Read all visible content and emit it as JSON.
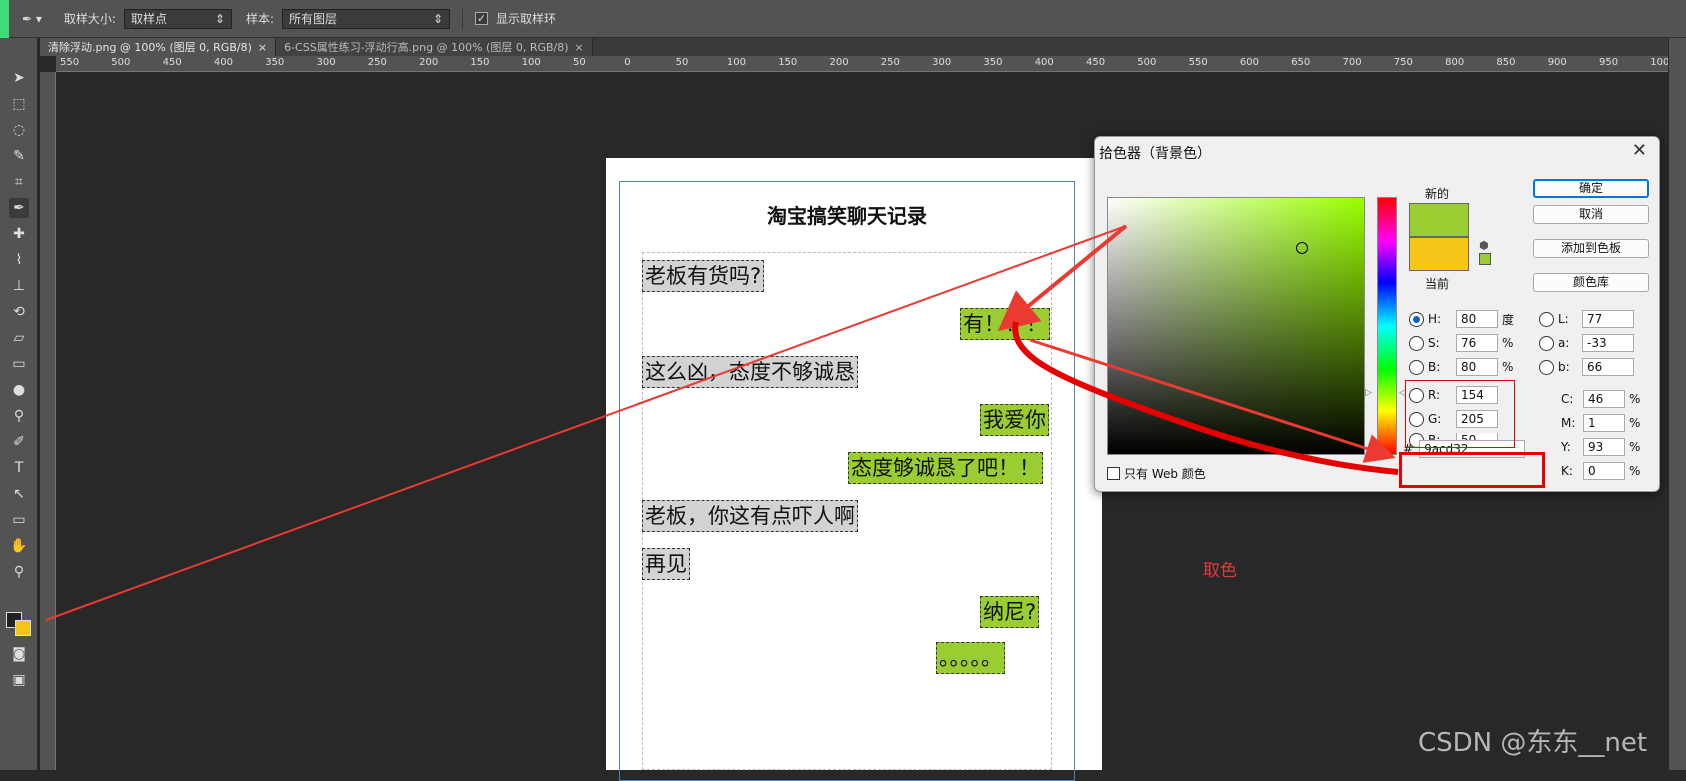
{
  "options": {
    "sample_size_label": "取样大小:",
    "sample_size_value": "取样点",
    "sample_label": "样本:",
    "sample_value": "所有图层",
    "show_ring_label": "显示取样环"
  },
  "tabs": [
    {
      "label": "清除浮动.png @ 100% (图层 0, RGB/8)",
      "close": "×"
    },
    {
      "label": "6-CSS属性练习-浮动行高.png @ 100% (图层 0, RGB/8)",
      "close": "×"
    }
  ],
  "ruler_ticks": [
    "550",
    "500",
    "450",
    "400",
    "350",
    "300",
    "250",
    "200",
    "150",
    "100",
    "50",
    "0",
    "50",
    "100",
    "150",
    "200",
    "250",
    "300",
    "350",
    "400",
    "450",
    "500",
    "550",
    "600",
    "650",
    "700",
    "750",
    "800",
    "850",
    "900",
    "950",
    "1000"
  ],
  "document": {
    "title": "淘宝搞笑聊天记录",
    "messages": [
      {
        "text": "老板有货吗?",
        "side": "left"
      },
      {
        "text": "有！！！",
        "side": "right"
      },
      {
        "text": "这么凶，态度不够诚恳",
        "side": "left"
      },
      {
        "text": "我爱你",
        "side": "right"
      },
      {
        "text": "态度够诚恳了吧！！",
        "side": "right"
      },
      {
        "text": "老板，你这有点吓人啊",
        "side": "left"
      },
      {
        "text": "再见",
        "side": "left"
      },
      {
        "text": "纳尼?",
        "side": "right"
      },
      {
        "text": "。。。。。",
        "side": "right"
      }
    ]
  },
  "picker": {
    "title": "拾色器（背景色）",
    "close": "✕",
    "new_label": "新的",
    "current_label": "当前",
    "new_color": "#9acd32",
    "current_color": "#f5c518",
    "buttons": {
      "ok": "确定",
      "cancel": "取消",
      "add": "添加到色板",
      "library": "颜色库"
    },
    "hsb": {
      "h_label": "H:",
      "h": "80",
      "h_unit": "度",
      "s_label": "S:",
      "s": "76",
      "s_unit": "%",
      "b_label": "B:",
      "b": "80",
      "b_unit": "%"
    },
    "rgb": {
      "r_label": "R:",
      "r": "154",
      "g_label": "G:",
      "g": "205",
      "b_label": "B:",
      "b": "50"
    },
    "lab": {
      "l_label": "L:",
      "l": "77",
      "a_label": "a:",
      "a": "-33",
      "b_label": "b:",
      "b": "66"
    },
    "cmyk": {
      "c_label": "C:",
      "c": "46",
      "m_label": "M:",
      "m": "1",
      "y_label": "Y:",
      "y": "93",
      "k_label": "K:",
      "k": "0",
      "unit": "%"
    },
    "hex_label": "#",
    "hex": "9acd32",
    "web_only": "只有 Web 颜色"
  },
  "annotation": {
    "caption": "取色",
    "color": "#e53935"
  },
  "watermark": "CSDN @东东__net"
}
